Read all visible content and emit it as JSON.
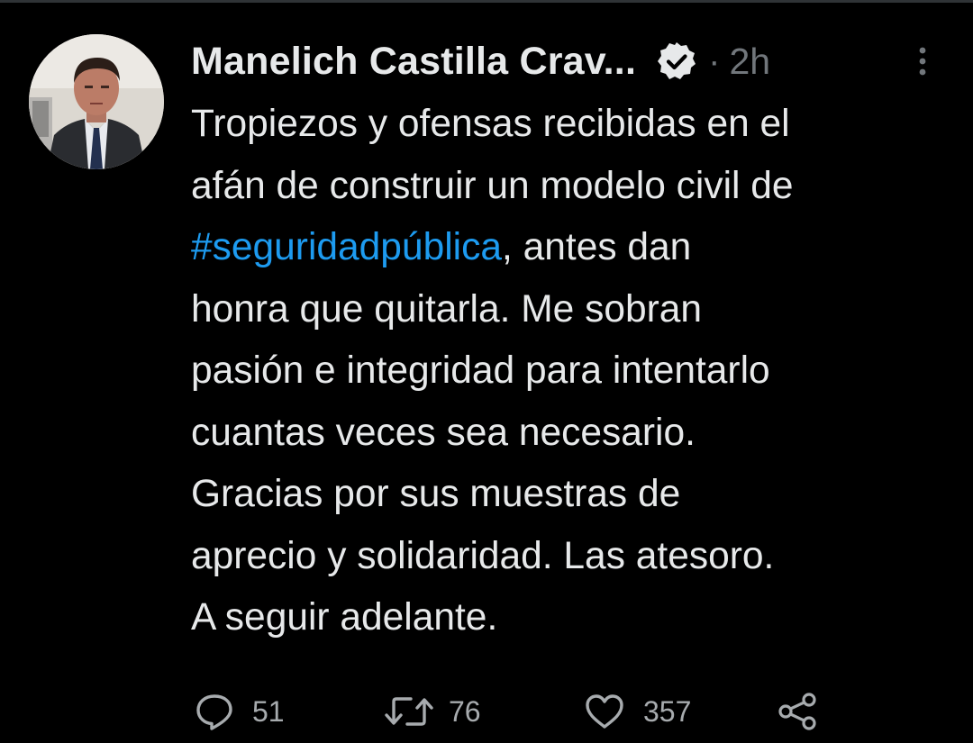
{
  "tweet": {
    "author_name": "Manelich Castilla Crav...",
    "separator": "·",
    "timestamp": "2h",
    "text_lines": [
      "Tropiezos y ofensas recibidas en el",
      "afán de construir un modelo civil de",
      "antes dan",
      "honra que quitarla. Me sobran",
      "pasión e integridad para intentarlo",
      "cuantas veces sea necesario.",
      "Gracias por sus muestras de",
      "aprecio y solidaridad. Las atesoro.",
      "A seguir adelante."
    ],
    "hashtag": "#seguridadpública",
    "after_hashtag": ",",
    "replies": "51",
    "retweets": "76",
    "likes": "357"
  },
  "icons": {
    "verified": "verified-badge-icon",
    "more": "more-vertical-icon",
    "reply": "reply-icon",
    "retweet": "retweet-icon",
    "like": "heart-icon",
    "share": "share-icon"
  },
  "colors": {
    "background": "#000000",
    "text": "#e7e9ea",
    "muted": "#71767b",
    "hashtag": "#1d9bf0"
  }
}
